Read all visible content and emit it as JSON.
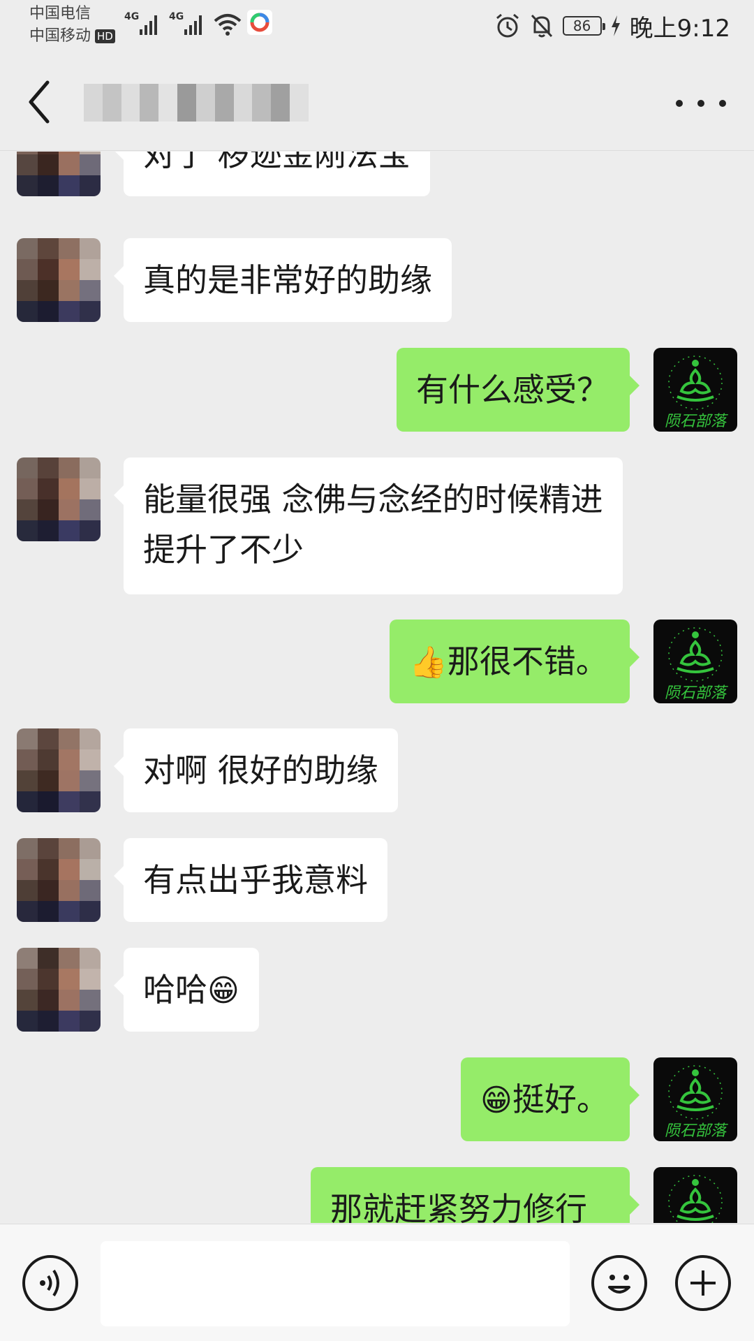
{
  "status_bar": {
    "carrier_1": "中国电信",
    "carrier_2": "中国移动",
    "hd_badge": "HD",
    "network_1": "4G",
    "network_2": "4G",
    "battery": "86",
    "time": "晚上9:12"
  },
  "header": {
    "back_icon": "chevron-left-icon",
    "more_icon": "more-dots-icon"
  },
  "messages": [
    {
      "side": "in",
      "text": "对了 秽迹金刚法宝"
    },
    {
      "side": "in",
      "text": "真的是非常好的助缘"
    },
    {
      "side": "out",
      "text": "有什么感受？"
    },
    {
      "side": "in",
      "line1": "能量很强 念佛与念经的时候精进",
      "line2": "提升了不少"
    },
    {
      "side": "out",
      "emoji": "👍",
      "text": "那很不错。"
    },
    {
      "side": "in",
      "text": "对啊 很好的助缘"
    },
    {
      "side": "in",
      "text": "有点出乎我意料"
    },
    {
      "side": "in",
      "text": "哈哈",
      "emoji": "😁"
    },
    {
      "side": "out",
      "emoji": "😁",
      "text": "挺好。"
    },
    {
      "side": "out",
      "text": "那就赶紧努力修行"
    }
  ],
  "own_avatar": {
    "caption": "陨石部落",
    "colors": {
      "bg": "#0a0a0a",
      "accent": "#35c43d"
    }
  },
  "input": {
    "placeholder": ""
  },
  "colors": {
    "outgoing_bubble": "#95ec69",
    "incoming_bubble": "#ffffff",
    "background": "#ededed"
  }
}
